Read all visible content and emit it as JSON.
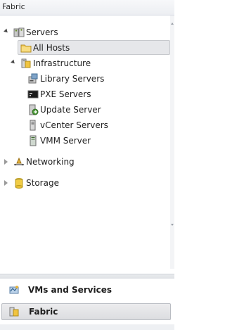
{
  "header": {
    "title": "Fabric"
  },
  "tree": {
    "servers": {
      "label": "Servers",
      "icon": "servers-icon"
    },
    "all_hosts": {
      "label": "All Hosts",
      "icon": "folder-icon"
    },
    "infrastructure": {
      "label": "Infrastructure",
      "icon": "infrastructure-icon"
    },
    "children": [
      {
        "label": "Library Servers",
        "icon": "library-server-icon"
      },
      {
        "label": "PXE Servers",
        "icon": "pxe-server-icon"
      },
      {
        "label": "Update Server",
        "icon": "update-server-icon"
      },
      {
        "label": "vCenter Servers",
        "icon": "vcenter-server-icon"
      },
      {
        "label": "VMM Server",
        "icon": "vmm-server-icon"
      }
    ],
    "networking": {
      "label": "Networking",
      "icon": "networking-icon"
    },
    "storage": {
      "label": "Storage",
      "icon": "storage-icon"
    }
  },
  "workspaces": {
    "vms": {
      "label": "VMs and Services",
      "icon": "vms-services-icon"
    },
    "fabric": {
      "label": "Fabric",
      "icon": "fabric-icon"
    }
  }
}
